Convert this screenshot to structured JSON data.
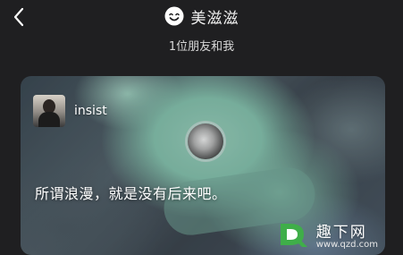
{
  "header": {
    "back_icon": "chevron-left-icon",
    "app_name": "美滋滋",
    "app_logo_icon": "smiley-face-icon",
    "subtitle": "1位朋友和我"
  },
  "card": {
    "user": {
      "name": "insist",
      "avatar_icon": "user-photo-avatar"
    },
    "quote": "所谓浪漫，就是没有后来吧。"
  },
  "watermark": {
    "logo_icon": "green-q-logo",
    "title": "趣下网",
    "url": "www.qzd.com"
  },
  "colors": {
    "background": "#1f1f21",
    "text": "#ffffff",
    "watermark_green": "#3fae49"
  }
}
